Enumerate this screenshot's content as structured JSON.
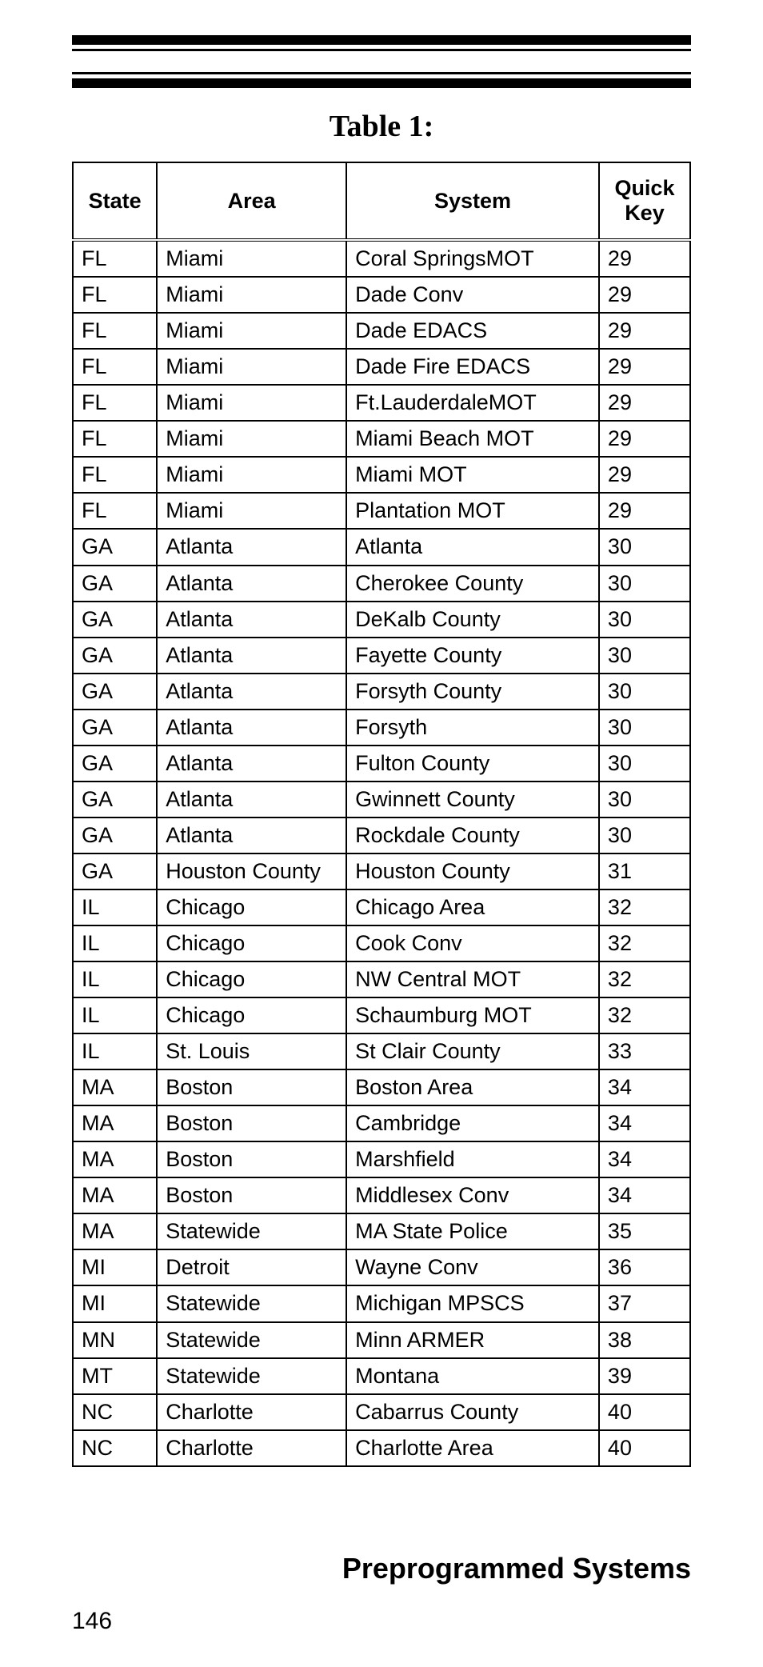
{
  "title": "Table 1:",
  "headers": {
    "state": "State",
    "area": "Area",
    "system": "System",
    "quick_key": "Quick Key"
  },
  "chart_data": {
    "type": "table",
    "columns": [
      "State",
      "Area",
      "System",
      "Quick Key"
    ],
    "rows": [
      [
        "FL",
        "Miami",
        "Coral SpringsMOT",
        "29"
      ],
      [
        "FL",
        "Miami",
        "Dade Conv",
        "29"
      ],
      [
        "FL",
        "Miami",
        "Dade EDACS",
        "29"
      ],
      [
        "FL",
        "Miami",
        "Dade Fire EDACS",
        "29"
      ],
      [
        "FL",
        "Miami",
        "Ft.LauderdaleMOT",
        "29"
      ],
      [
        "FL",
        "Miami",
        "Miami Beach MOT",
        "29"
      ],
      [
        "FL",
        "Miami",
        "Miami MOT",
        "29"
      ],
      [
        "FL",
        "Miami",
        "Plantation MOT",
        "29"
      ],
      [
        "GA",
        "Atlanta",
        "Atlanta",
        "30"
      ],
      [
        "GA",
        "Atlanta",
        "Cherokee County",
        "30"
      ],
      [
        "GA",
        "Atlanta",
        "DeKalb County",
        "30"
      ],
      [
        "GA",
        "Atlanta",
        "Fayette County",
        "30"
      ],
      [
        "GA",
        "Atlanta",
        "Forsyth County",
        "30"
      ],
      [
        "GA",
        "Atlanta",
        "Forsyth",
        "30"
      ],
      [
        "GA",
        "Atlanta",
        "Fulton County",
        "30"
      ],
      [
        "GA",
        "Atlanta",
        "Gwinnett County",
        "30"
      ],
      [
        "GA",
        "Atlanta",
        "Rockdale County",
        "30"
      ],
      [
        "GA",
        "Houston County",
        "Houston County",
        "31"
      ],
      [
        "IL",
        "Chicago",
        "Chicago Area",
        "32"
      ],
      [
        "IL",
        "Chicago",
        "Cook Conv",
        "32"
      ],
      [
        "IL",
        "Chicago",
        "NW Central MOT",
        "32"
      ],
      [
        "IL",
        "Chicago",
        "Schaumburg MOT",
        "32"
      ],
      [
        "IL",
        "St. Louis",
        "St Clair County",
        "33"
      ],
      [
        "MA",
        "Boston",
        "Boston Area",
        "34"
      ],
      [
        "MA",
        "Boston",
        "Cambridge",
        "34"
      ],
      [
        "MA",
        "Boston",
        "Marshfield",
        "34"
      ],
      [
        "MA",
        "Boston",
        "Middlesex Conv",
        "34"
      ],
      [
        "MA",
        "Statewide",
        "MA State Police",
        "35"
      ],
      [
        "MI",
        "Detroit",
        "Wayne Conv",
        "36"
      ],
      [
        "MI",
        "Statewide",
        "Michigan MPSCS",
        "37"
      ],
      [
        "MN",
        "Statewide",
        "Minn ARMER",
        "38"
      ],
      [
        "MT",
        "Statewide",
        "Montana",
        "39"
      ],
      [
        "NC",
        "Charlotte",
        "Cabarrus County",
        "40"
      ],
      [
        "NC",
        "Charlotte",
        "Charlotte Area",
        "40"
      ]
    ]
  },
  "section_title": "Preprogrammed Systems",
  "page_number": "146"
}
